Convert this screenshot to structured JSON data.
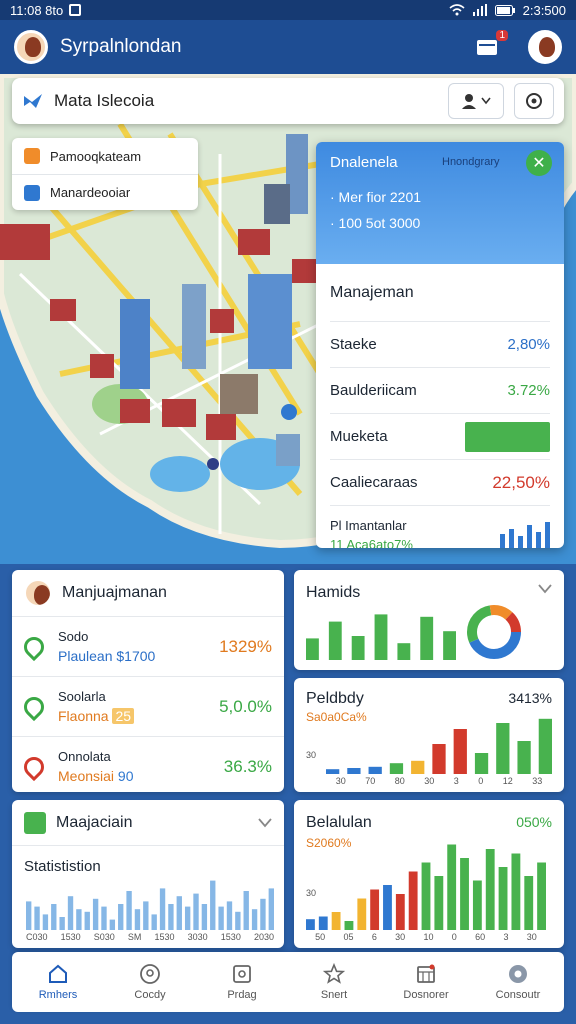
{
  "status": {
    "time_left": "11:08 8to",
    "time_right": "2:3:500"
  },
  "app": {
    "title": "Syrpalnlondan",
    "notif_count": "1"
  },
  "search": {
    "value": "Mata Islecoia"
  },
  "map_layers": [
    {
      "label": "Pamooqkateam",
      "color": "#f08c2a"
    },
    {
      "label": "Manardeooiar",
      "color": "#2f78d0"
    }
  ],
  "info_panel": {
    "title": "Dnalenela",
    "tag": "Hnondgrary",
    "line1": "· Mer fior 2201",
    "line2": "· 100 5ot 3000",
    "heading": "Manajeman",
    "rows": [
      {
        "label": "Staeke",
        "value": "2,80%"
      },
      {
        "label": "Baulderiicam",
        "value": "3.72%"
      },
      {
        "label": "Mueketa",
        "bar_fraction": 0.85
      },
      {
        "label": "Caaliecaraas",
        "value": "22,50%"
      }
    ],
    "footer_label": "Pl Imantanlar",
    "footer_value": "11 Aca6ato7%",
    "mini_bars": [
      0.55,
      0.7,
      0.45,
      0.85,
      0.6,
      0.95
    ]
  },
  "manage_card": {
    "title": "Manjuajmanan",
    "rows": [
      {
        "title": "Sodo",
        "sub": "Plaulean",
        "extra": "$1700",
        "value": "1329%",
        "color": "#3aa845",
        "value_color": "#e07a1f"
      },
      {
        "title": "Soolarla",
        "sub": "Flaonna",
        "extra": "25",
        "value": "5,0.0%",
        "color": "#3aa845",
        "value_color": "#3aa845"
      },
      {
        "title": "Onnolata",
        "sub": "Meonsiai",
        "extra": "90",
        "value": "36.3%",
        "color": "#d23a2c",
        "value_color": "#3aa845"
      }
    ]
  },
  "hamids_card": {
    "title": "Hamids",
    "bars": [
      0.45,
      0.8,
      0.5,
      0.95,
      0.35,
      0.9,
      0.6
    ]
  },
  "pelding_card": {
    "title": "Peldbdy",
    "value": "3413%",
    "sub": "Sa0a0Ca%",
    "ytick": "30",
    "xlabels": [
      "30",
      "70",
      "80",
      "30",
      "3",
      "0",
      "12",
      "33"
    ],
    "bars": [
      {
        "v": 0.08,
        "color": "#2f78d0"
      },
      {
        "v": 0.1,
        "color": "#2f78d0"
      },
      {
        "v": 0.12,
        "color": "#2f78d0"
      },
      {
        "v": 0.18,
        "color": "#48b24e"
      },
      {
        "v": 0.22,
        "color": "#f2b431"
      },
      {
        "v": 0.5,
        "color": "#d23a2c"
      },
      {
        "v": 0.75,
        "color": "#d23a2c"
      },
      {
        "v": 0.35,
        "color": "#48b24e"
      },
      {
        "v": 0.85,
        "color": "#48b24e"
      },
      {
        "v": 0.55,
        "color": "#48b24e"
      },
      {
        "v": 0.92,
        "color": "#48b24e"
      }
    ]
  },
  "majacian_card": {
    "title": "Maajaciain",
    "subtitle": "Statististion",
    "xlabels": [
      "C030",
      "1530",
      "S030",
      "SM",
      "1530",
      "3030",
      "1530",
      "2030"
    ],
    "bars": [
      0.55,
      0.45,
      0.3,
      0.5,
      0.25,
      0.65,
      0.4,
      0.35,
      0.6,
      0.45,
      0.2,
      0.5,
      0.75,
      0.4,
      0.55,
      0.3,
      0.8,
      0.5,
      0.65,
      0.45,
      0.7,
      0.5,
      0.95,
      0.45,
      0.55,
      0.35,
      0.75,
      0.4,
      0.6,
      0.8
    ]
  },
  "belulun_card": {
    "title": "Belalulan",
    "value": "050%",
    "sub": "S2060%",
    "ytick": "30",
    "xlabels": [
      "50",
      "05",
      "6",
      "30",
      "10",
      "0",
      "60",
      "3",
      "30"
    ],
    "bars": [
      {
        "v": 0.12,
        "color": "#2f78d0"
      },
      {
        "v": 0.15,
        "color": "#2f78d0"
      },
      {
        "v": 0.2,
        "color": "#f2b431"
      },
      {
        "v": 0.1,
        "color": "#48b24e"
      },
      {
        "v": 0.35,
        "color": "#f2b431"
      },
      {
        "v": 0.45,
        "color": "#d23a2c"
      },
      {
        "v": 0.5,
        "color": "#2f78d0"
      },
      {
        "v": 0.4,
        "color": "#d23a2c"
      },
      {
        "v": 0.65,
        "color": "#d23a2c"
      },
      {
        "v": 0.75,
        "color": "#48b24e"
      },
      {
        "v": 0.6,
        "color": "#48b24e"
      },
      {
        "v": 0.95,
        "color": "#48b24e"
      },
      {
        "v": 0.8,
        "color": "#48b24e"
      },
      {
        "v": 0.55,
        "color": "#48b24e"
      },
      {
        "v": 0.9,
        "color": "#48b24e"
      },
      {
        "v": 0.7,
        "color": "#48b24e"
      },
      {
        "v": 0.85,
        "color": "#48b24e"
      },
      {
        "v": 0.6,
        "color": "#48b24e"
      },
      {
        "v": 0.75,
        "color": "#48b24e"
      }
    ]
  },
  "nav": [
    {
      "label": "Rmhers",
      "icon": "home-icon",
      "active": true
    },
    {
      "label": "Cocdy",
      "icon": "location-icon",
      "active": false
    },
    {
      "label": "Prdag",
      "icon": "tile-icon",
      "active": false
    },
    {
      "label": "Snert",
      "icon": "star-icon",
      "active": false
    },
    {
      "label": "Dosnorer",
      "icon": "calendar-icon",
      "active": false
    },
    {
      "label": "Consoutr",
      "icon": "settings-icon",
      "active": false
    }
  ]
}
